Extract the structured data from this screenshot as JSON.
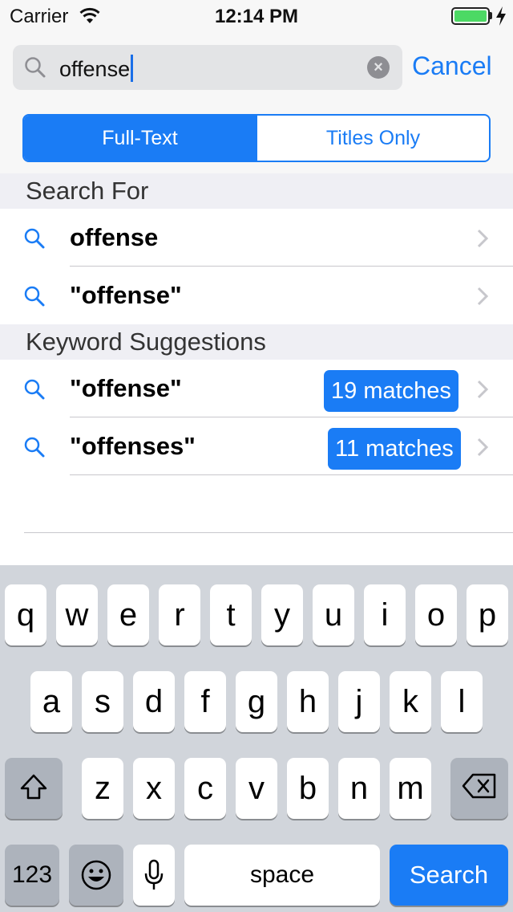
{
  "status_bar": {
    "carrier": "Carrier",
    "time": "12:14 PM"
  },
  "search": {
    "query": "offense",
    "cancel_label": "Cancel"
  },
  "segments": [
    {
      "label": "Full-Text",
      "selected": true
    },
    {
      "label": "Titles Only",
      "selected": false
    }
  ],
  "search_for": {
    "header": "Search For",
    "items": [
      {
        "label": "offense"
      },
      {
        "label": "\"offense\""
      }
    ]
  },
  "keyword_suggestions": {
    "header": "Keyword Suggestions",
    "items": [
      {
        "label": "\"offense\"",
        "matches": "19 matches"
      },
      {
        "label": "\"offenses\"",
        "matches": "11 matches"
      }
    ]
  },
  "keyboard": {
    "row1": [
      "q",
      "w",
      "e",
      "r",
      "t",
      "y",
      "u",
      "i",
      "o",
      "p"
    ],
    "row2": [
      "a",
      "s",
      "d",
      "f",
      "g",
      "h",
      "j",
      "k",
      "l"
    ],
    "row3": [
      "z",
      "x",
      "c",
      "v",
      "b",
      "n",
      "m"
    ],
    "numbers_label": "123",
    "space_label": "space",
    "search_label": "Search"
  },
  "colors": {
    "accent": "#1a7cf5",
    "battery": "#4cd964",
    "keyboard_bg": "#d1d5db"
  }
}
